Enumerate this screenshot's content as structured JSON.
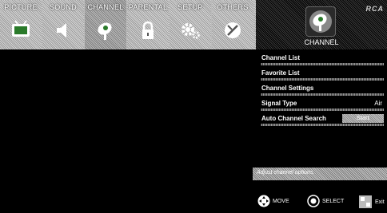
{
  "tabs": [
    {
      "label": "PICTURE",
      "icon": "tv-icon"
    },
    {
      "label": "SOUND",
      "icon": "speaker-icon"
    },
    {
      "label": "CHANNEL",
      "icon": "satellite-dish-icon"
    },
    {
      "label": "PARENTAL",
      "icon": "lock-icon"
    },
    {
      "label": "SETUP",
      "icon": "gears-icon"
    },
    {
      "label": "OTHERS",
      "icon": "others-icon"
    }
  ],
  "brand": "RCA",
  "panel": {
    "title": "CHANNEL",
    "items": [
      {
        "label": "Channel List"
      },
      {
        "label": "Favorite List"
      },
      {
        "label": "Channel Settings"
      },
      {
        "label": "Signal Type",
        "value": "Air"
      },
      {
        "label": "Auto Channel Search",
        "button": "Start"
      }
    ],
    "help": "Adjust channel options."
  },
  "footer": {
    "move": "MOVE",
    "select": "SELECT",
    "exit": "Exit"
  }
}
